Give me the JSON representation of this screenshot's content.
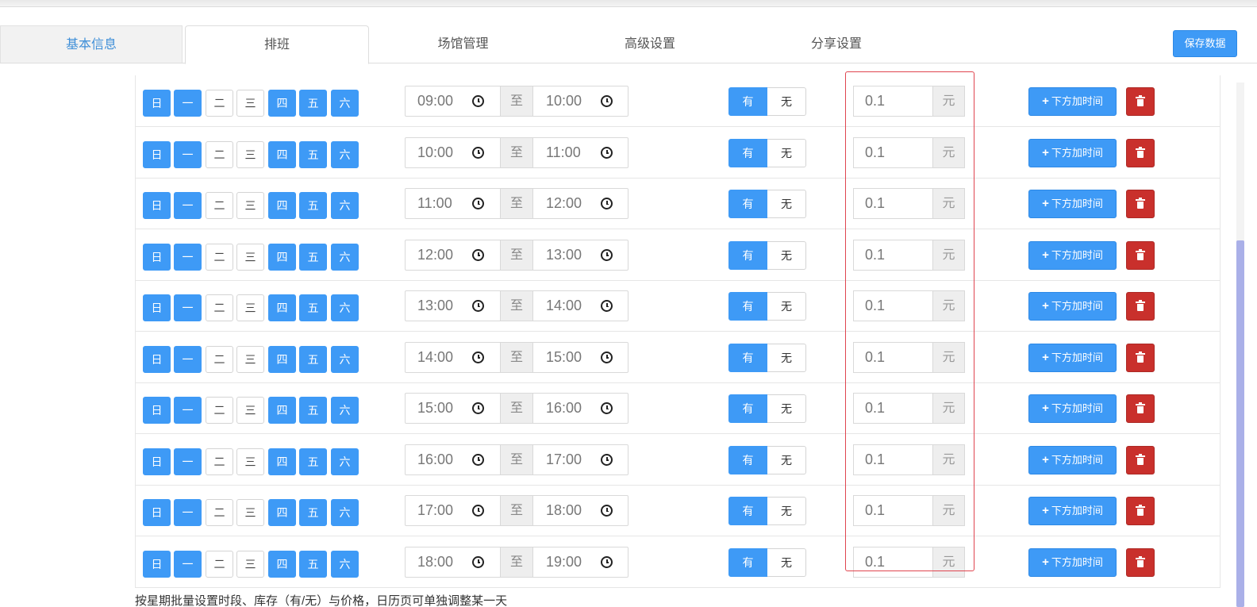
{
  "tabs": [
    {
      "label": "基本信息"
    },
    {
      "label": "排班"
    },
    {
      "label": "场馆管理"
    },
    {
      "label": "高级设置"
    },
    {
      "label": "分享设置"
    }
  ],
  "save_button": "保存数据",
  "colors": {
    "primary": "#3e9af6",
    "danger": "#c9302c",
    "highlight": "#e0454f"
  },
  "schedule": {
    "day_labels": [
      "日",
      "一",
      "二",
      "三",
      "四",
      "五",
      "六"
    ],
    "day_selected": [
      true,
      true,
      false,
      false,
      true,
      true,
      true
    ],
    "to_label": "至",
    "stock_yes": "有",
    "stock_no": "无",
    "stock_selected": "有",
    "price_unit": "元",
    "add_label": "下方加时间",
    "rows": [
      {
        "start": "09:00",
        "end": "10:00",
        "price": "0.1"
      },
      {
        "start": "10:00",
        "end": "11:00",
        "price": "0.1"
      },
      {
        "start": "11:00",
        "end": "12:00",
        "price": "0.1"
      },
      {
        "start": "12:00",
        "end": "13:00",
        "price": "0.1"
      },
      {
        "start": "13:00",
        "end": "14:00",
        "price": "0.1"
      },
      {
        "start": "14:00",
        "end": "15:00",
        "price": "0.1"
      },
      {
        "start": "15:00",
        "end": "16:00",
        "price": "0.1"
      },
      {
        "start": "16:00",
        "end": "17:00",
        "price": "0.1"
      },
      {
        "start": "17:00",
        "end": "18:00",
        "price": "0.1"
      },
      {
        "start": "18:00",
        "end": "19:00",
        "price": "0.1"
      }
    ]
  },
  "footer_note": "按星期批量设置时段、库存（有/无）与价格，日历页可单独调整某一天"
}
